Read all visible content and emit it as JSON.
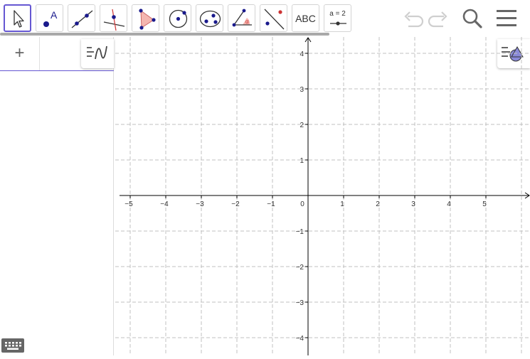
{
  "toolbar": {
    "text_tool_label": "ABC",
    "slider_tool_label": "a = 2",
    "tools": [
      "move-tool",
      "point-tool",
      "line-tool",
      "perpendicular-line-tool",
      "polygon-tool",
      "circle-tool",
      "conic-tool",
      "angle-tool",
      "reflect-tool",
      "text-tool",
      "slider-tool"
    ],
    "right": [
      "undo-icon",
      "redo-icon",
      "search-icon",
      "hamburger-menu-icon"
    ]
  },
  "algebra": {
    "add_label": "+"
  },
  "graphics": {
    "x_ticks": [
      "−5",
      "−4",
      "−3",
      "−2",
      "−1",
      "0",
      "1",
      "2",
      "3",
      "4",
      "5"
    ],
    "y_ticks": [
      "4",
      "3",
      "2",
      "1",
      "−1",
      "−2",
      "−3",
      "−4"
    ]
  },
  "colors": {
    "accent": "#6557d2",
    "point": "#1a1a8c",
    "grid": "#c0c0c0",
    "axis": "#000000"
  }
}
